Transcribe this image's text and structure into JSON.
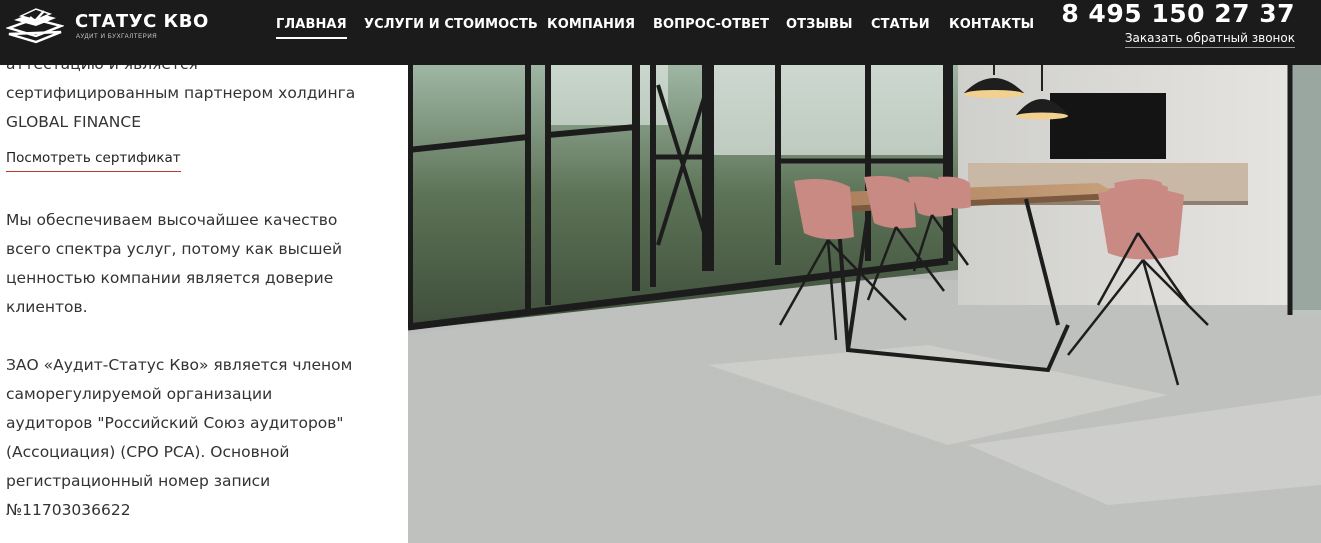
{
  "header": {
    "logo": {
      "title": "СТАТУС КВО",
      "subtitle": "АУДИТ И БУХГАЛТЕРИЯ"
    },
    "nav": [
      {
        "label": "ГЛАВНАЯ",
        "active": true
      },
      {
        "label": "УСЛУГИ И СТОИМОСТЬ",
        "active": false
      },
      {
        "label": "КОМПАНИЯ",
        "active": false
      },
      {
        "label": "ВОПРОС-ОТВЕТ",
        "active": false
      },
      {
        "label": "ОТЗЫВЫ",
        "active": false
      },
      {
        "label": "СТАТЬИ",
        "active": false
      },
      {
        "label": "КОНТАКТЫ",
        "active": false
      }
    ],
    "phone": "8 495 150 27 37",
    "callback_label": "Заказать обратный звонок"
  },
  "content": {
    "intro_lines": [
      "аттестацию и является",
      "сертифицированным партнером холдинга",
      "GLOBAL FINANCE"
    ],
    "certificate_link": "Посмотреть сертификат",
    "quality_paragraph_lines": [
      "Мы обеспечиваем высочайшее качество",
      "всего спектра услуг, потому как высшей",
      "ценностью компании является доверие",
      "клиентов."
    ],
    "member_paragraph_lines": [
      "ЗАО «Аудит-Статус Кво» является членом",
      "саморегулируемой организации",
      "аудиторов \"Российский Союз аудиторов\"",
      "(Ассоциация) (СРО РСА). Основной",
      "регистрационный номер записи",
      "№11703036622"
    ]
  },
  "photo": {
    "subject": "office-interior-photo"
  },
  "colors": {
    "header_bg": "#1b1b1b",
    "link_underline": "#c0392b",
    "body_text": "#333333"
  }
}
